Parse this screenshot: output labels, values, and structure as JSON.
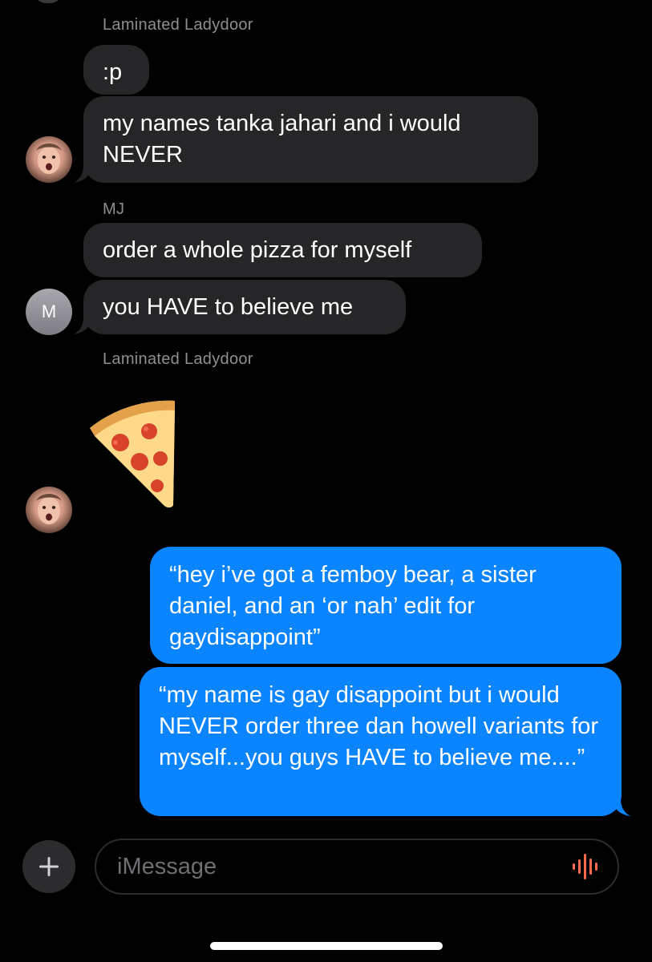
{
  "conversation": {
    "groups": [
      {
        "sender": "Laminated Ladydoor",
        "messages": [
          ":p",
          "my names tanka jahari and i would NEVER"
        ]
      },
      {
        "sender": "MJ",
        "avatar_initial": "M",
        "messages": [
          "order a whole pizza for myself",
          "you HAVE to believe me"
        ]
      },
      {
        "sender": "Laminated Ladydoor",
        "emoji": "pizza"
      }
    ],
    "outgoing": [
      "“hey i’ve got a femboy bear, a sister daniel, and an ‘or nah’ edit for gaydisappoint”",
      "“my name is gay disappoint but i would NEVER order three dan howell variants for myself...you guys HAVE to believe me....”"
    ]
  },
  "composer": {
    "placeholder": "iMessage",
    "plus_icon": "plus-icon",
    "audio_icon": "audio-waveform-icon"
  },
  "colors": {
    "incoming_bubble": "#262628",
    "outgoing_bubble": "#0a84ff",
    "sender_label": "#8e8e93",
    "audio_icon": "#ff6b4a"
  }
}
